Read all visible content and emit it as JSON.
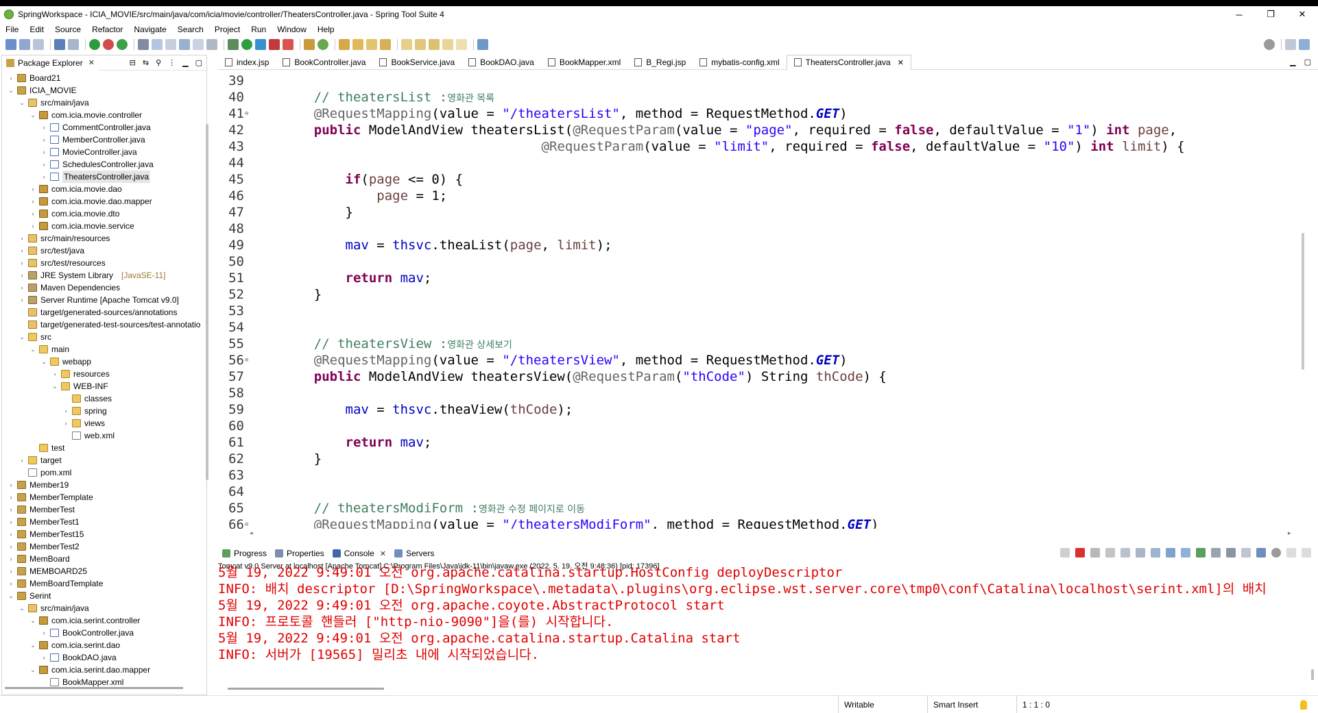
{
  "window": {
    "title": "SpringWorkspace - ICIA_MOVIE/src/main/java/com/icia/movie/controller/TheatersController.java - Spring Tool Suite 4",
    "minimize": "─",
    "maximize": "❐",
    "close": "✕"
  },
  "menu": [
    "File",
    "Edit",
    "Source",
    "Refactor",
    "Navigate",
    "Search",
    "Project",
    "Run",
    "Window",
    "Help"
  ],
  "package_explorer": {
    "tab_label": "Package Explorer",
    "tree": [
      {
        "label": "Board21",
        "twisty": "›",
        "icon": "proj",
        "level": 0
      },
      {
        "label": "ICIA_MOVIE",
        "twisty": "⌄",
        "icon": "proj",
        "level": 0
      },
      {
        "label": "src/main/java",
        "twisty": "⌄",
        "icon": "srcf",
        "level": 1
      },
      {
        "label": "com.icia.movie.controller",
        "twisty": "⌄",
        "icon": "pkg",
        "level": 2
      },
      {
        "label": "CommentController.java",
        "twisty": "›",
        "icon": "jav",
        "level": 3
      },
      {
        "label": "MemberController.java",
        "twisty": "›",
        "icon": "jav",
        "level": 3
      },
      {
        "label": "MovieController.java",
        "twisty": "›",
        "icon": "jav",
        "level": 3
      },
      {
        "label": "SchedulesController.java",
        "twisty": "›",
        "icon": "jav",
        "level": 3
      },
      {
        "label": "TheatersController.java",
        "twisty": "›",
        "icon": "jav",
        "level": 3,
        "selected": true
      },
      {
        "label": "com.icia.movie.dao",
        "twisty": "›",
        "icon": "pkg",
        "level": 2
      },
      {
        "label": "com.icia.movie.dao.mapper",
        "twisty": "›",
        "icon": "pkg",
        "level": 2
      },
      {
        "label": "com.icia.movie.dto",
        "twisty": "›",
        "icon": "pkg",
        "level": 2
      },
      {
        "label": "com.icia.movie.service",
        "twisty": "›",
        "icon": "pkg",
        "level": 2
      },
      {
        "label": "src/main/resources",
        "twisty": "›",
        "icon": "srcf",
        "level": 1
      },
      {
        "label": "src/test/java",
        "twisty": "›",
        "icon": "srcf",
        "level": 1
      },
      {
        "label": "src/test/resources",
        "twisty": "›",
        "icon": "srcf",
        "level": 1
      },
      {
        "label": "JRE System Library",
        "decor": "[JavaSE-11]",
        "twisty": "›",
        "icon": "jar",
        "level": 1
      },
      {
        "label": "Maven Dependencies",
        "twisty": "›",
        "icon": "jar",
        "level": 1
      },
      {
        "label": "Server Runtime [Apache Tomcat v9.0]",
        "twisty": "›",
        "icon": "jar",
        "level": 1
      },
      {
        "label": "target/generated-sources/annotations",
        "twisty": "",
        "icon": "srcf",
        "level": 1
      },
      {
        "label": "target/generated-test-sources/test-annotatio",
        "twisty": "",
        "icon": "srcf",
        "level": 1
      },
      {
        "label": "src",
        "twisty": "⌄",
        "icon": "fold",
        "level": 1
      },
      {
        "label": "main",
        "twisty": "⌄",
        "icon": "fold",
        "level": 2
      },
      {
        "label": "webapp",
        "twisty": "⌄",
        "icon": "fold",
        "level": 3
      },
      {
        "label": "resources",
        "twisty": "›",
        "icon": "fold",
        "level": 4
      },
      {
        "label": "WEB-INF",
        "twisty": "⌄",
        "icon": "fold",
        "level": 4
      },
      {
        "label": "classes",
        "twisty": "",
        "icon": "fold",
        "level": 5
      },
      {
        "label": "spring",
        "twisty": "›",
        "icon": "fold",
        "level": 5
      },
      {
        "label": "views",
        "twisty": "›",
        "icon": "fold",
        "level": 5
      },
      {
        "label": "web.xml",
        "twisty": "",
        "icon": "xml",
        "level": 5
      },
      {
        "label": "test",
        "twisty": "",
        "icon": "fold",
        "level": 2
      },
      {
        "label": "target",
        "twisty": "›",
        "icon": "fold",
        "level": 1
      },
      {
        "label": "pom.xml",
        "twisty": "",
        "icon": "xml",
        "level": 1
      },
      {
        "label": "Member19",
        "twisty": "›",
        "icon": "proj",
        "level": 0
      },
      {
        "label": "MemberTemplate",
        "twisty": "›",
        "icon": "proj",
        "level": 0
      },
      {
        "label": "MemberTest",
        "twisty": "›",
        "icon": "proj",
        "level": 0
      },
      {
        "label": "MemberTest1",
        "twisty": "›",
        "icon": "proj",
        "level": 0
      },
      {
        "label": "MemberTest15",
        "twisty": "›",
        "icon": "proj",
        "level": 0
      },
      {
        "label": "MemberTest2",
        "twisty": "›",
        "icon": "proj",
        "level": 0
      },
      {
        "label": "MemBoard",
        "twisty": "›",
        "icon": "proj",
        "level": 0
      },
      {
        "label": "MEMBOARD25",
        "twisty": "›",
        "icon": "proj",
        "level": 0
      },
      {
        "label": "MemBoardTemplate",
        "twisty": "›",
        "icon": "proj",
        "level": 0
      },
      {
        "label": "Serint",
        "twisty": "⌄",
        "icon": "proj",
        "level": 0
      },
      {
        "label": "src/main/java",
        "twisty": "⌄",
        "icon": "srcf",
        "level": 1
      },
      {
        "label": "com.icia.serint.controller",
        "twisty": "⌄",
        "icon": "pkg",
        "level": 2
      },
      {
        "label": "BookController.java",
        "twisty": "›",
        "icon": "jav",
        "level": 3
      },
      {
        "label": "com.icia.serint.dao",
        "twisty": "⌄",
        "icon": "pkg",
        "level": 2
      },
      {
        "label": "BookDAO.java",
        "twisty": "›",
        "icon": "jav",
        "level": 3
      },
      {
        "label": "com.icia.serint.dao.mapper",
        "twisty": "⌄",
        "icon": "pkg",
        "level": 2
      },
      {
        "label": "BookMapper.xml",
        "twisty": "",
        "icon": "xml",
        "level": 3
      }
    ]
  },
  "editor": {
    "tabs": [
      {
        "label": "index.jsp",
        "active": false
      },
      {
        "label": "BookController.java",
        "active": false
      },
      {
        "label": "BookService.java",
        "active": false
      },
      {
        "label": "BookDAO.java",
        "active": false
      },
      {
        "label": "BookMapper.xml",
        "active": false
      },
      {
        "label": "B_Regi.jsp",
        "active": false
      },
      {
        "label": "mybatis-config.xml",
        "active": false
      },
      {
        "label": "TheatersController.java",
        "active": true
      }
    ],
    "lines": [
      {
        "n": "39",
        "tokens": []
      },
      {
        "n": "40",
        "tokens": [
          [
            "cm",
            "    // theatersList :"
          ],
          [
            "cmk",
            "영화관 목록"
          ]
        ]
      },
      {
        "n": "41",
        "fold": true,
        "tokens": [
          [
            "an",
            "    @RequestMapping"
          ],
          [
            "",
            "(value = "
          ],
          [
            "st",
            "\"/theatersList\""
          ],
          [
            "",
            ", method = RequestMethod."
          ],
          [
            "stat",
            "GET"
          ],
          [
            "",
            ")"
          ]
        ]
      },
      {
        "n": "42",
        "tokens": [
          [
            "kw",
            "    public"
          ],
          [
            "",
            " ModelAndView theatersList("
          ],
          [
            "an",
            "@RequestParam"
          ],
          [
            "",
            "(value = "
          ],
          [
            "st",
            "\"page\""
          ],
          [
            "",
            ", required = "
          ],
          [
            "kw",
            "false"
          ],
          [
            "",
            ", defaultValue = "
          ],
          [
            "st",
            "\"1\""
          ],
          [
            "",
            ") "
          ],
          [
            "kw",
            "int"
          ],
          [
            "prm",
            " page"
          ],
          [
            "",
            ","
          ]
        ]
      },
      {
        "n": "43",
        "tokens": [
          [
            "",
            "                                 "
          ],
          [
            "an",
            "@RequestParam"
          ],
          [
            "",
            "(value = "
          ],
          [
            "st",
            "\"limit\""
          ],
          [
            "",
            ", required = "
          ],
          [
            "kw",
            "false"
          ],
          [
            "",
            ", defaultValue = "
          ],
          [
            "st",
            "\"10\""
          ],
          [
            "",
            ") "
          ],
          [
            "kw",
            "int"
          ],
          [
            "prm",
            " limit"
          ],
          [
            "",
            ") {"
          ]
        ]
      },
      {
        "n": "44",
        "tokens": []
      },
      {
        "n": "45",
        "tokens": [
          [
            "kw",
            "        if"
          ],
          [
            "",
            "("
          ],
          [
            "prm",
            "page"
          ],
          [
            "",
            " <= 0) {"
          ]
        ]
      },
      {
        "n": "46",
        "tokens": [
          [
            "prm",
            "            page"
          ],
          [
            "",
            " = 1;"
          ]
        ]
      },
      {
        "n": "47",
        "tokens": [
          [
            "",
            "        }"
          ]
        ]
      },
      {
        "n": "48",
        "tokens": []
      },
      {
        "n": "49",
        "tokens": [
          [
            "fld",
            "        mav"
          ],
          [
            "",
            " = "
          ],
          [
            "fld",
            "thsvc"
          ],
          [
            "",
            ".theaList("
          ],
          [
            "prm",
            "page"
          ],
          [
            "",
            ", "
          ],
          [
            "prm",
            "limit"
          ],
          [
            "",
            ");"
          ]
        ]
      },
      {
        "n": "50",
        "tokens": []
      },
      {
        "n": "51",
        "tokens": [
          [
            "kw",
            "        return"
          ],
          [
            "fld",
            " mav"
          ],
          [
            "",
            ";"
          ]
        ]
      },
      {
        "n": "52",
        "tokens": [
          [
            "",
            "    }"
          ]
        ]
      },
      {
        "n": "53",
        "tokens": []
      },
      {
        "n": "54",
        "tokens": []
      },
      {
        "n": "55",
        "tokens": [
          [
            "cm",
            "    // theatersView :"
          ],
          [
            "cmk",
            "영화관 상세보기"
          ]
        ]
      },
      {
        "n": "56",
        "fold": true,
        "tokens": [
          [
            "an",
            "    @RequestMapping"
          ],
          [
            "",
            "(value = "
          ],
          [
            "st",
            "\"/theatersView\""
          ],
          [
            "",
            ", method = RequestMethod."
          ],
          [
            "stat",
            "GET"
          ],
          [
            "",
            ")"
          ]
        ]
      },
      {
        "n": "57",
        "tokens": [
          [
            "kw",
            "    public"
          ],
          [
            "",
            " ModelAndView theatersView("
          ],
          [
            "an",
            "@RequestParam"
          ],
          [
            "",
            "("
          ],
          [
            "st",
            "\"thCode\""
          ],
          [
            "",
            ") String "
          ],
          [
            "prm",
            "thCode"
          ],
          [
            "",
            ") {"
          ]
        ]
      },
      {
        "n": "58",
        "tokens": []
      },
      {
        "n": "59",
        "tokens": [
          [
            "fld",
            "        mav"
          ],
          [
            "",
            " = "
          ],
          [
            "fld",
            "thsvc"
          ],
          [
            "",
            ".theaView("
          ],
          [
            "prm",
            "thCode"
          ],
          [
            "",
            ");"
          ]
        ]
      },
      {
        "n": "60",
        "tokens": []
      },
      {
        "n": "61",
        "tokens": [
          [
            "kw",
            "        return"
          ],
          [
            "fld",
            " mav"
          ],
          [
            "",
            ";"
          ]
        ]
      },
      {
        "n": "62",
        "tokens": [
          [
            "",
            "    }"
          ]
        ]
      },
      {
        "n": "63",
        "tokens": []
      },
      {
        "n": "64",
        "tokens": []
      },
      {
        "n": "65",
        "tokens": [
          [
            "cm",
            "    // theatersModiForm :"
          ],
          [
            "cmk",
            "영화관 수정 페이지로 이동"
          ]
        ]
      },
      {
        "n": "66",
        "fold": true,
        "tokens": [
          [
            "an",
            "    @RequestMapping"
          ],
          [
            "",
            "(value = "
          ],
          [
            "st",
            "\"/theatersModiForm\""
          ],
          [
            "",
            ", method = RequestMethod."
          ],
          [
            "stat",
            "GET"
          ],
          [
            "",
            ")"
          ]
        ]
      }
    ]
  },
  "bottom_panel": {
    "tabs": [
      {
        "label": "Progress",
        "active": false
      },
      {
        "label": "Properties",
        "active": false
      },
      {
        "label": "Console",
        "active": true
      },
      {
        "label": "Servers",
        "active": false
      }
    ],
    "console_header": "Tomcat v9.0 Server at localhost [Apache Tomcat] C:\\Program Files\\Java\\jdk-11\\bin\\javaw.exe  (2022. 5. 19. 오전 9:48:36) [pid: 17396]",
    "output": [
      "5월 19, 2022 9:49:01 오전 org.apache.catalina.startup.HostConfig deployDescriptor",
      "INFO: 배치 descriptor [D:\\SpringWorkspace\\.metadata\\.plugins\\org.eclipse.wst.server.core\\tmp0\\conf\\Catalina\\localhost\\serint.xml]의 배치",
      "5월 19, 2022 9:49:01 오전 org.apache.coyote.AbstractProtocol start",
      "INFO: 프로토콜 핸들러 [\"http-nio-9090\"]을(를) 시작합니다.",
      "5월 19, 2022 9:49:01 오전 org.apache.catalina.startup.Catalina start",
      "INFO: 서버가 [19565] 밀리초 내에 시작되었습니다."
    ]
  },
  "status": {
    "mode": "Writable",
    "insert": "Smart Insert",
    "position": "1 : 1 : 0"
  },
  "colors": {
    "keyword": "#7f0055",
    "comment": "#3f7f5f",
    "string": "#2a00ff",
    "field": "#0000c0",
    "console_text": "#e00000"
  }
}
